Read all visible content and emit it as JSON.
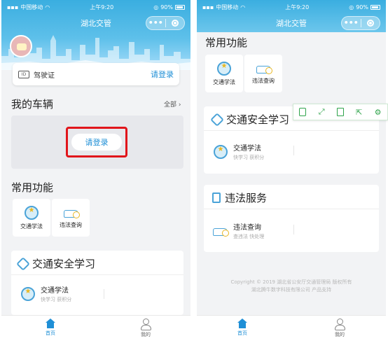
{
  "colors": {
    "accent": "#1f8fd6",
    "highlight_border": "#e1151b",
    "toolbar": "#2ea34a"
  },
  "left": {
    "status": {
      "carrier": "中国移动",
      "time": "上午9:20",
      "battery": "90%"
    },
    "nav": {
      "title": "湖北交管",
      "more": "•••"
    },
    "license": {
      "icon": "ID",
      "label": "驾驶证",
      "login": "请登录"
    },
    "vehicles": {
      "title": "我的车辆",
      "more": "全部",
      "login": "请登录"
    },
    "functions": {
      "title": "常用功能",
      "items": [
        {
          "label": "交通学法",
          "icon": "medal-icon"
        },
        {
          "label": "违法查询",
          "icon": "car-search-icon"
        }
      ]
    },
    "study": {
      "title": "交通安全学习",
      "item": {
        "title": "交通学法",
        "subtitle": "快学习 获积分"
      }
    },
    "tabs": [
      {
        "label": "首页",
        "icon": "home-icon"
      },
      {
        "label": "我的",
        "icon": "person-icon"
      }
    ]
  },
  "right": {
    "status": {
      "carrier": "中国移动",
      "time": "上午9:20",
      "battery": "90%"
    },
    "nav": {
      "title": "湖北交管",
      "more": "•••"
    },
    "functions": {
      "title": "常用功能",
      "items": [
        {
          "label": "交通学法",
          "icon": "medal-icon"
        },
        {
          "label": "违法查询",
          "icon": "car-search-icon"
        }
      ]
    },
    "study": {
      "title": "交通安全学习",
      "item": {
        "title": "交通学法",
        "subtitle": "快学习 获积分"
      }
    },
    "violation": {
      "title": "违法服务",
      "item": {
        "title": "违法查询",
        "subtitle": "查违法 快处理"
      }
    },
    "copyright": {
      "line1": "Copyright © 2019 湖北省公安厅交通管理局 版权所有",
      "line2": "湖北腾牛数字科技有限公司 产品支持"
    },
    "tabs": [
      {
        "label": "首页",
        "icon": "home-icon"
      },
      {
        "label": "我的",
        "icon": "person-icon"
      }
    ]
  },
  "toolbar": {
    "icons": [
      "copy-icon",
      "fullscreen-icon",
      "save-icon",
      "share-icon",
      "settings-icon"
    ]
  }
}
